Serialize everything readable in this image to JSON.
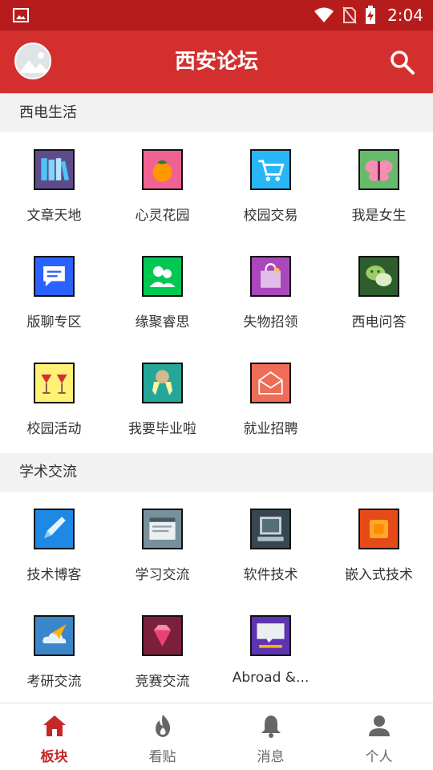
{
  "status_bar": {
    "time": "2:04"
  },
  "app_bar": {
    "title": "西安论坛"
  },
  "sections": [
    {
      "title": "西电生活",
      "items": [
        {
          "label": "文章天地",
          "icon": "books-icon",
          "color": "#5e4b8b"
        },
        {
          "label": "心灵花园",
          "icon": "fruit-icon",
          "color": "#f06292"
        },
        {
          "label": "校园交易",
          "icon": "shopping-cart-icon",
          "color": "#29b6f6"
        },
        {
          "label": "我是女生",
          "icon": "butterfly-icon",
          "color": "#66bb6a"
        },
        {
          "label": "版聊专区",
          "icon": "chat-bubble-icon",
          "color": "#2962ff"
        },
        {
          "label": "缘聚睿思",
          "icon": "people-icon",
          "color": "#00c853"
        },
        {
          "label": "失物招领",
          "icon": "shopping-bag-icon",
          "color": "#ab47bc"
        },
        {
          "label": "西电问答",
          "icon": "wechat-icon",
          "color": "#2e5d2e"
        },
        {
          "label": "校园活动",
          "icon": "cocktail-glasses-icon",
          "color": "#fff176"
        },
        {
          "label": "我要毕业啦",
          "icon": "medal-icon",
          "color": "#26a69a"
        },
        {
          "label": "就业招聘",
          "icon": "envelope-icon",
          "color": "#ef6c57"
        }
      ]
    },
    {
      "title": "学术交流",
      "items": [
        {
          "label": "技术博客",
          "icon": "pencil-icon",
          "color": "#1e88e5"
        },
        {
          "label": "学习交流",
          "icon": "browser-window-icon",
          "color": "#78909c"
        },
        {
          "label": "软件技术",
          "icon": "computer-icon",
          "color": "#37474f"
        },
        {
          "label": "嵌入式技术",
          "icon": "chip-icon",
          "color": "#e64a19"
        },
        {
          "label": "考研交流",
          "icon": "paper-plane-cloud-icon",
          "color": "#3a86c8"
        },
        {
          "label": "竞赛交流",
          "icon": "diamond-icon",
          "color": "#7b1f3a"
        },
        {
          "label": "Abroad &...",
          "icon": "english-chat-icon",
          "color": "#5e35b1"
        }
      ]
    }
  ],
  "bottom_nav": [
    {
      "label": "板块",
      "icon": "home-icon",
      "active": true
    },
    {
      "label": "看贴",
      "icon": "flame-icon",
      "active": false
    },
    {
      "label": "消息",
      "icon": "bell-icon",
      "active": false
    },
    {
      "label": "个人",
      "icon": "person-icon",
      "active": false
    }
  ],
  "colors": {
    "primary": "#d32f2f",
    "status_bar": "#b71c1c",
    "active_nav": "#c62828"
  }
}
